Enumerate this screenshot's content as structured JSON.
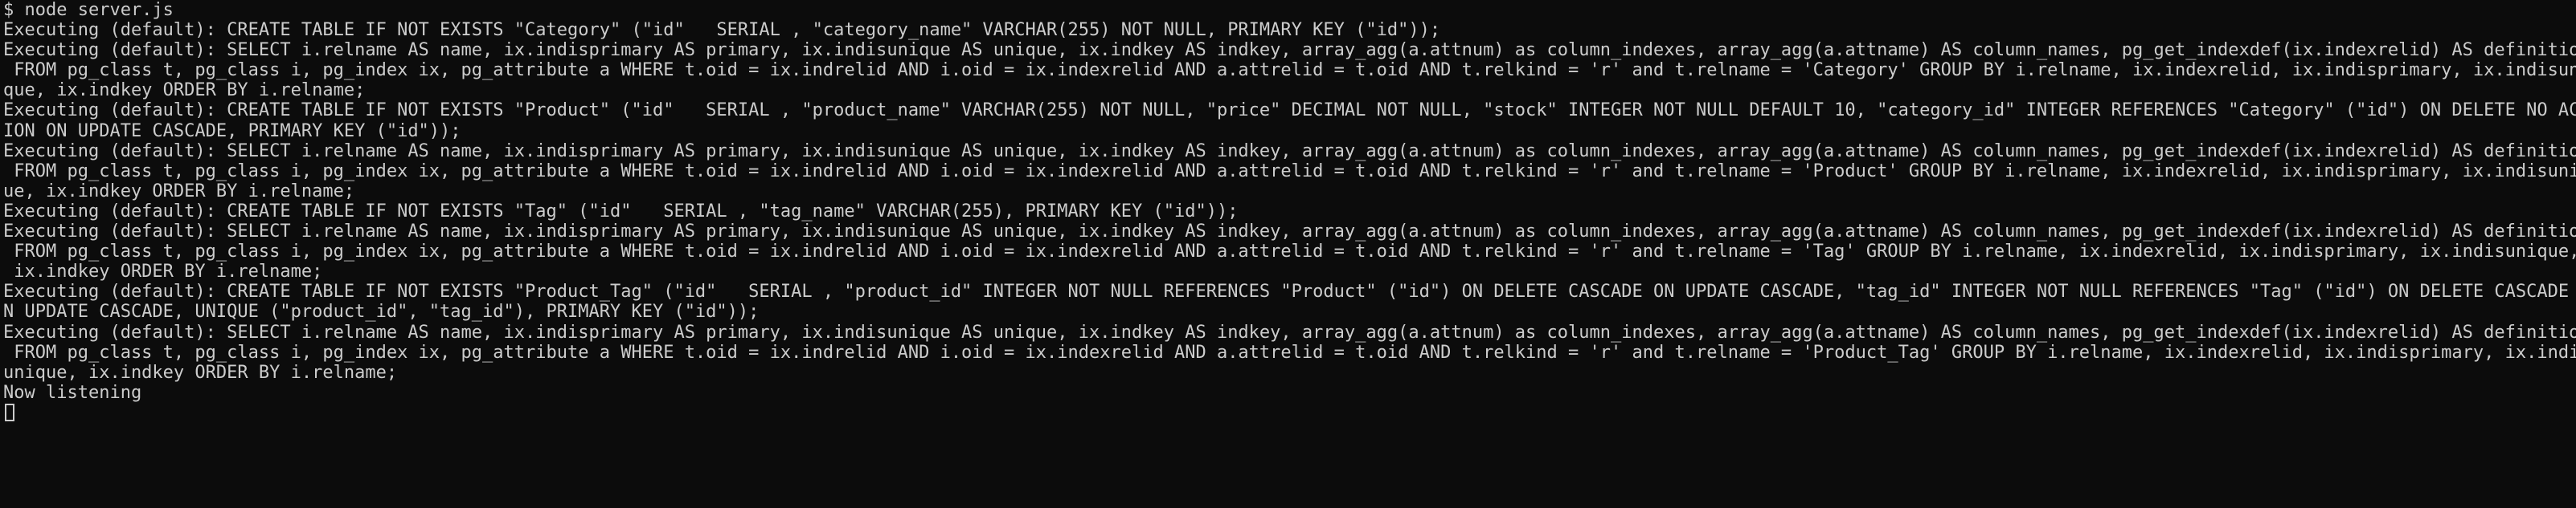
{
  "terminal": {
    "lines": [
      "$ node server.js",
      "Executing (default): CREATE TABLE IF NOT EXISTS \"Category\" (\"id\"   SERIAL , \"category_name\" VARCHAR(255) NOT NULL, PRIMARY KEY (\"id\"));",
      "Executing (default): SELECT i.relname AS name, ix.indisprimary AS primary, ix.indisunique AS unique, ix.indkey AS indkey, array_agg(a.attnum) as column_indexes, array_agg(a.attname) AS column_names, pg_get_indexdef(ix.indexrelid) AS definition",
      " FROM pg_class t, pg_class i, pg_index ix, pg_attribute a WHERE t.oid = ix.indrelid AND i.oid = ix.indexrelid AND a.attrelid = t.oid AND t.relkind = 'r' and t.relname = 'Category' GROUP BY i.relname, ix.indexrelid, ix.indisprimary, ix.indisuni",
      "que, ix.indkey ORDER BY i.relname;",
      "Executing (default): CREATE TABLE IF NOT EXISTS \"Product\" (\"id\"   SERIAL , \"product_name\" VARCHAR(255) NOT NULL, \"price\" DECIMAL NOT NULL, \"stock\" INTEGER NOT NULL DEFAULT 10, \"category_id\" INTEGER REFERENCES \"Category\" (\"id\") ON DELETE NO ACT",
      "ION ON UPDATE CASCADE, PRIMARY KEY (\"id\"));",
      "Executing (default): SELECT i.relname AS name, ix.indisprimary AS primary, ix.indisunique AS unique, ix.indkey AS indkey, array_agg(a.attnum) as column_indexes, array_agg(a.attname) AS column_names, pg_get_indexdef(ix.indexrelid) AS definition",
      " FROM pg_class t, pg_class i, pg_index ix, pg_attribute a WHERE t.oid = ix.indrelid AND i.oid = ix.indexrelid AND a.attrelid = t.oid AND t.relkind = 'r' and t.relname = 'Product' GROUP BY i.relname, ix.indexrelid, ix.indisprimary, ix.indisuniq",
      "ue, ix.indkey ORDER BY i.relname;",
      "Executing (default): CREATE TABLE IF NOT EXISTS \"Tag\" (\"id\"   SERIAL , \"tag_name\" VARCHAR(255), PRIMARY KEY (\"id\"));",
      "Executing (default): SELECT i.relname AS name, ix.indisprimary AS primary, ix.indisunique AS unique, ix.indkey AS indkey, array_agg(a.attnum) as column_indexes, array_agg(a.attname) AS column_names, pg_get_indexdef(ix.indexrelid) AS definition",
      " FROM pg_class t, pg_class i, pg_index ix, pg_attribute a WHERE t.oid = ix.indrelid AND i.oid = ix.indexrelid AND a.attrelid = t.oid AND t.relkind = 'r' and t.relname = 'Tag' GROUP BY i.relname, ix.indexrelid, ix.indisprimary, ix.indisunique,",
      " ix.indkey ORDER BY i.relname;",
      "Executing (default): CREATE TABLE IF NOT EXISTS \"Product_Tag\" (\"id\"   SERIAL , \"product_id\" INTEGER NOT NULL REFERENCES \"Product\" (\"id\") ON DELETE CASCADE ON UPDATE CASCADE, \"tag_id\" INTEGER NOT NULL REFERENCES \"Tag\" (\"id\") ON DELETE CASCADE O",
      "N UPDATE CASCADE, UNIQUE (\"product_id\", \"tag_id\"), PRIMARY KEY (\"id\"));",
      "Executing (default): SELECT i.relname AS name, ix.indisprimary AS primary, ix.indisunique AS unique, ix.indkey AS indkey, array_agg(a.attnum) as column_indexes, array_agg(a.attname) AS column_names, pg_get_indexdef(ix.indexrelid) AS definition",
      " FROM pg_class t, pg_class i, pg_index ix, pg_attribute a WHERE t.oid = ix.indrelid AND i.oid = ix.indexrelid AND a.attrelid = t.oid AND t.relkind = 'r' and t.relname = 'Product_Tag' GROUP BY i.relname, ix.indexrelid, ix.indisprimary, ix.indis",
      "unique, ix.indkey ORDER BY i.relname;",
      "Now listening"
    ]
  },
  "colors": {
    "background": "#0c0c0c",
    "foreground": "#cccccc"
  }
}
